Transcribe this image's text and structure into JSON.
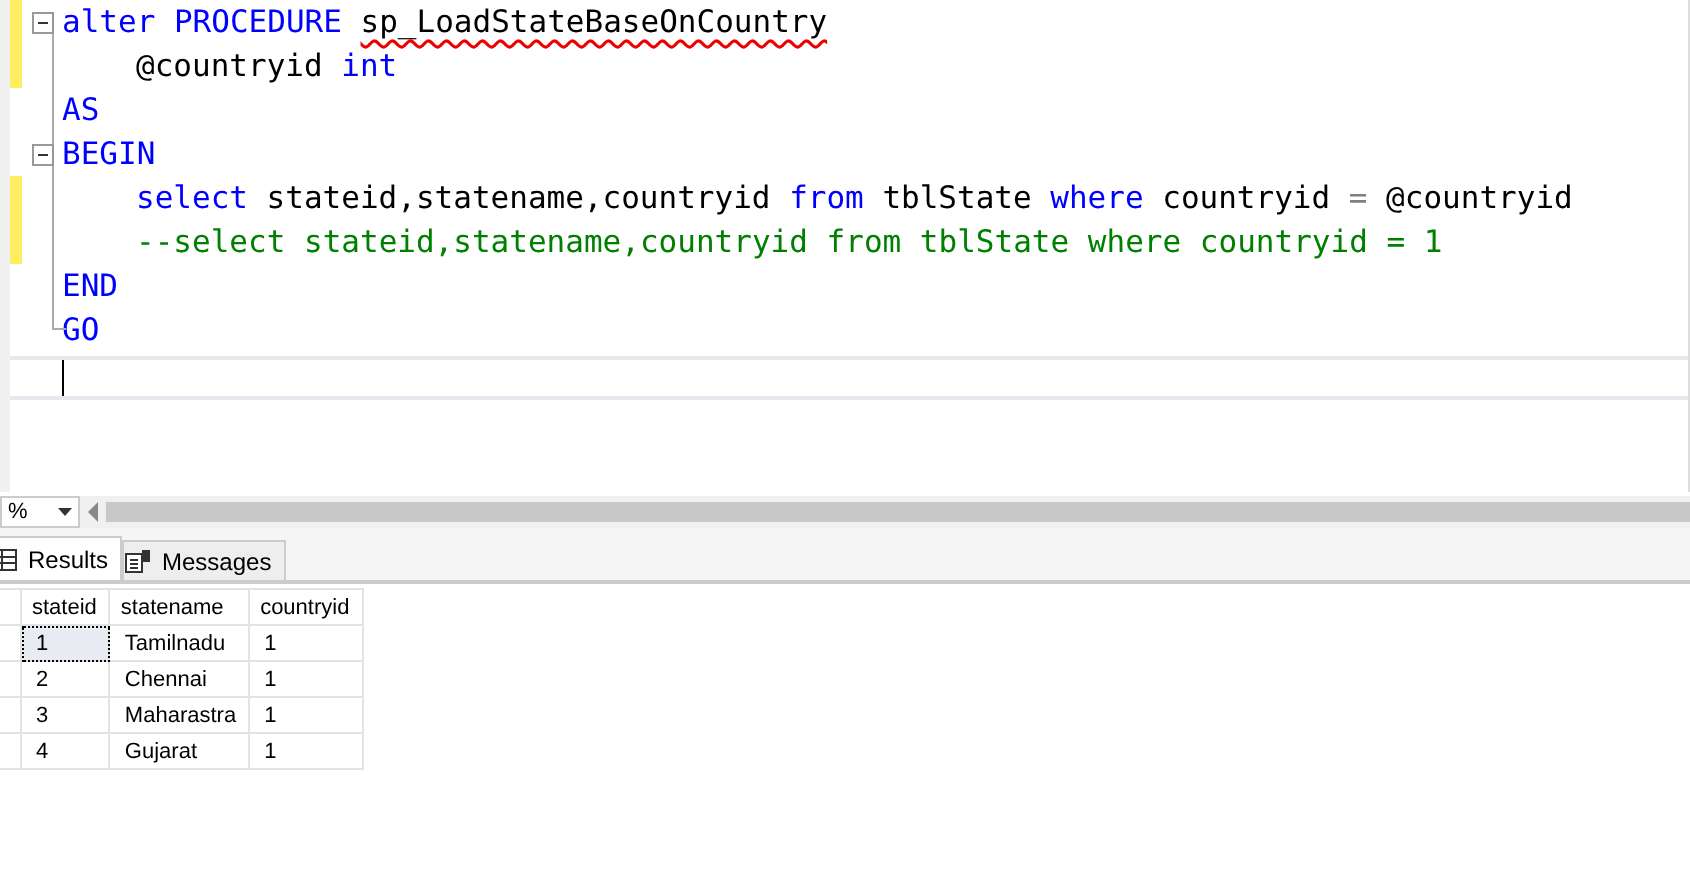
{
  "editor": {
    "lines": [
      {
        "changed": true,
        "fold": true,
        "indented": false,
        "current": false,
        "tokens": [
          {
            "kind": "keyword",
            "text": "alter"
          },
          {
            "kind": "keyword",
            "text": "PROCEDURE"
          },
          {
            "kind": "error",
            "text": "sp_LoadStateBaseOnCountry"
          }
        ]
      },
      {
        "changed": true,
        "fold": false,
        "indented": true,
        "current": false,
        "tokens": [
          {
            "kind": "plain",
            "text": "@countryid"
          },
          {
            "kind": "keyword",
            "text": "int"
          }
        ]
      },
      {
        "changed": false,
        "fold": false,
        "indented": false,
        "current": false,
        "tokens": [
          {
            "kind": "keyword",
            "text": "AS"
          }
        ]
      },
      {
        "changed": false,
        "fold": true,
        "indented": false,
        "current": false,
        "tokens": [
          {
            "kind": "keyword",
            "text": "BEGIN"
          }
        ]
      },
      {
        "changed": true,
        "fold": false,
        "indented": true,
        "current": false,
        "tokens": [
          {
            "kind": "keyword",
            "text": "select"
          },
          {
            "kind": "plain",
            "text": "stateid,statename,countryid"
          },
          {
            "kind": "keyword",
            "text": "from"
          },
          {
            "kind": "plain",
            "text": "tblState"
          },
          {
            "kind": "keyword",
            "text": "where"
          },
          {
            "kind": "plain",
            "text": "countryid"
          },
          {
            "kind": "operator",
            "text": "="
          },
          {
            "kind": "plain",
            "text": "@countryid"
          }
        ]
      },
      {
        "changed": true,
        "fold": false,
        "indented": true,
        "current": false,
        "tokens": [
          {
            "kind": "comment",
            "text": "--select stateid,statename,countryid from tblState where countryid = 1"
          }
        ]
      },
      {
        "changed": false,
        "fold": false,
        "indented": false,
        "current": false,
        "tokens": [
          {
            "kind": "keyword",
            "text": "END"
          }
        ]
      },
      {
        "changed": false,
        "fold": false,
        "indented": false,
        "current": false,
        "tokens": [
          {
            "kind": "keyword",
            "text": "GO"
          }
        ]
      },
      {
        "changed": false,
        "fold": false,
        "indented": false,
        "current": true
      }
    ]
  },
  "zoom": {
    "value": "%"
  },
  "tabs": [
    {
      "label": "Results",
      "selected": true
    },
    {
      "label": "Messages",
      "selected": false
    }
  ],
  "table": {
    "columns": [
      "stateid",
      "statename",
      "countryid"
    ],
    "rows": [
      {
        "selected": true,
        "cells": [
          "1",
          "Tamilnadu",
          "1"
        ]
      },
      {
        "selected": false,
        "cells": [
          "2",
          "Chennai",
          "1"
        ]
      },
      {
        "selected": false,
        "cells": [
          "3",
          "Maharastra",
          "1"
        ]
      },
      {
        "selected": false,
        "cells": [
          "4",
          "Gujarat",
          "1"
        ]
      }
    ]
  }
}
